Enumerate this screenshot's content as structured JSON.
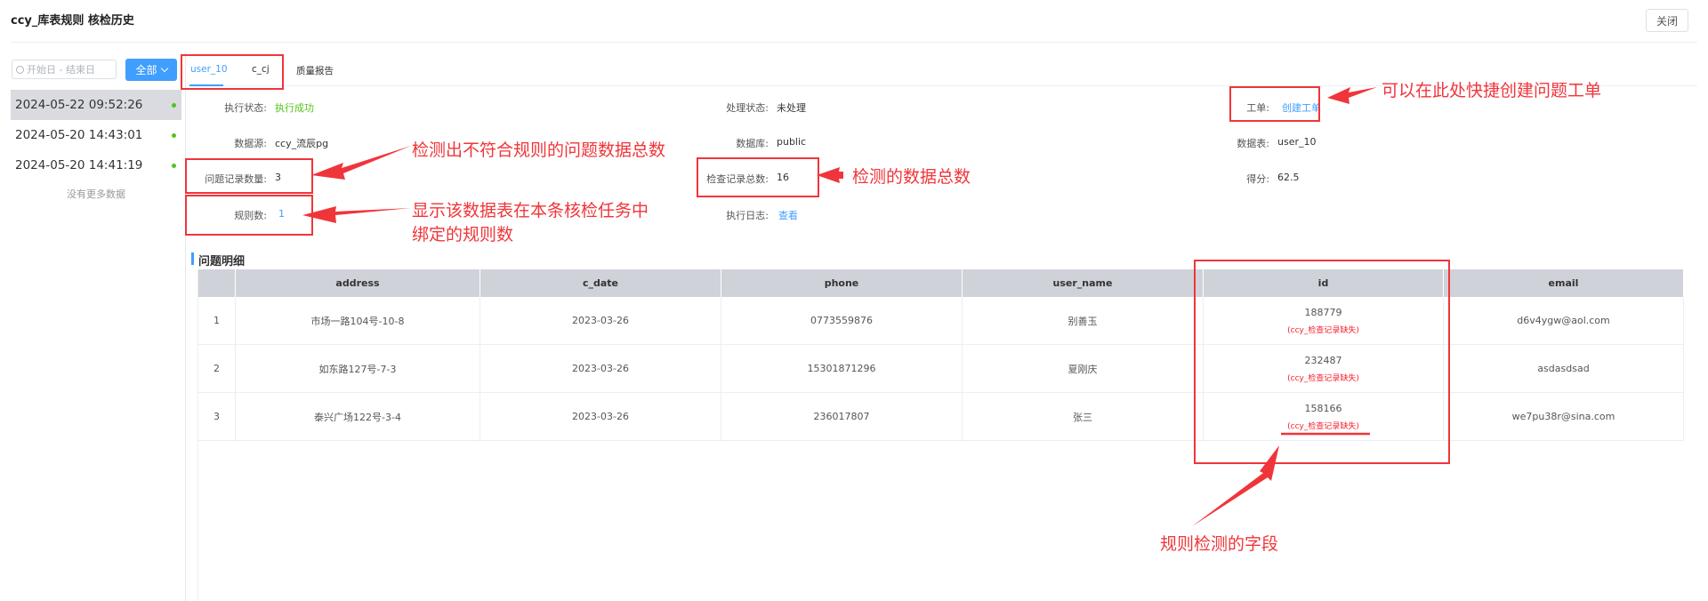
{
  "header": {
    "title": "ccy_库表规则 核检历史",
    "close_label": "关闭"
  },
  "filter": {
    "date_placeholder": "开始日 - 结束日",
    "scope_label": "全部"
  },
  "history": {
    "items": [
      {
        "time": "2024-05-22 09:52:26",
        "active": true
      },
      {
        "time": "2024-05-20 14:43:01",
        "active": false
      },
      {
        "time": "2024-05-20 14:41:19",
        "active": false
      }
    ],
    "no_more": "没有更多数据"
  },
  "tabs": [
    {
      "label": "user_10",
      "active": true
    },
    {
      "label": "c_cj",
      "active": false
    },
    {
      "label": "质量报告",
      "active": false
    }
  ],
  "info": {
    "exec_status_label": "执行状态:",
    "exec_status_value": "执行成功",
    "proc_status_label": "处理状态:",
    "proc_status_value": "未处理",
    "ticket_label": "工单:",
    "ticket_value": "创建工单",
    "datasource_label": "数据源:",
    "datasource_value": "ccy_流辰pg",
    "database_label": "数据库:",
    "database_value": "public",
    "table_label": "数据表:",
    "table_value": "user_10",
    "issue_count_label": "问题记录数量:",
    "issue_count_value": "3",
    "check_total_label": "检查记录总数:",
    "check_total_value": "16",
    "score_label": "得分:",
    "score_value": "62.5",
    "rule_count_label": "规则数:",
    "rule_count_value": "1",
    "log_label": "执行日志:",
    "log_value": "查看"
  },
  "details": {
    "section_title": "问题明细",
    "columns": [
      "",
      "address",
      "c_date",
      "phone",
      "user_name",
      "id",
      "email"
    ],
    "rows": [
      {
        "no": "1",
        "address": "市场一路104号-10-8",
        "c_date": "2023-03-26",
        "phone": "0773559876",
        "user_name": "别善玉",
        "id": "188779",
        "id_err": "(ccy_检查记录缺失)",
        "email": "d6v4ygw@aol.com"
      },
      {
        "no": "2",
        "address": "如东路127号-7-3",
        "c_date": "2023-03-26",
        "phone": "15301871296",
        "user_name": "夏刚庆",
        "id": "232487",
        "id_err": "(ccy_检查记录缺失)",
        "email": "asdasdsad"
      },
      {
        "no": "3",
        "address": "泰兴广场122号-3-4",
        "c_date": "2023-03-26",
        "phone": "236017807",
        "user_name": "张三",
        "id": "158166",
        "id_err": "(ccy_检查记录缺失)",
        "email": "we7pu38r@sina.com"
      }
    ]
  },
  "annotations": {
    "ticket": "可以在此处快捷创建问题工单",
    "issue_count": "检测出不符合规则的问题数据总数",
    "check_total": "检测的数据总数",
    "rule_count_line1": "显示该数据表在本条核检任务中",
    "rule_count_line2": "绑定的规则数",
    "field": "规则检测的字段"
  },
  "colors": {
    "accent": "#409eff",
    "success": "#52c41a",
    "annotation": "#f0353a",
    "header_bg": "#cfd2d9"
  }
}
